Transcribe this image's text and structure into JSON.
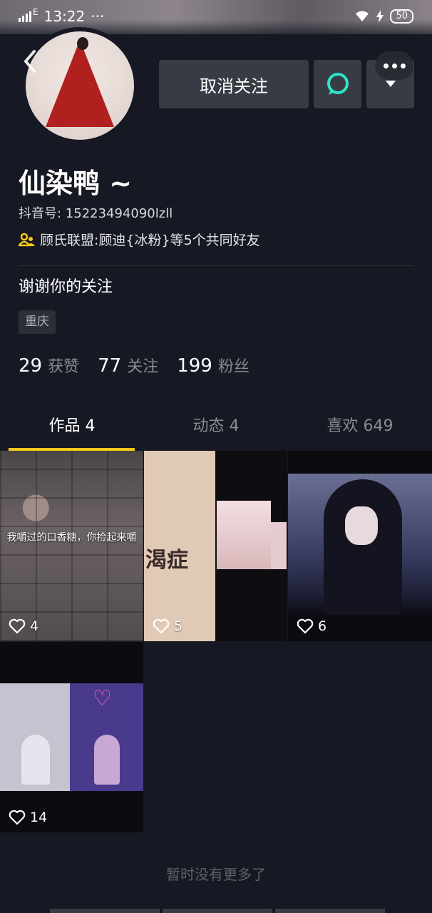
{
  "status_bar": {
    "network": "E",
    "time": "13:22",
    "dots": "···",
    "battery": "50"
  },
  "header": {
    "unfollow_label": "取消关注"
  },
  "profile": {
    "nickname": "仙染鸭 ~",
    "douyin_id": "抖音号: 15223494090lzll",
    "mutual_friends": "顾氏联盟:顾迪{冰粉}等5个共同好友",
    "bio": "谢谢你的关注",
    "location": "重庆"
  },
  "stats": [
    {
      "value": "29",
      "label": "获赞"
    },
    {
      "value": "77",
      "label": "关注"
    },
    {
      "value": "199",
      "label": "粉丝"
    }
  ],
  "tabs": [
    {
      "label": "作品 4",
      "active": true
    },
    {
      "label": "动态 4",
      "active": false
    },
    {
      "label": "喜欢 649",
      "active": false
    }
  ],
  "videos": [
    {
      "likes": "4",
      "caption": "我嚼过的口香糖，你捡起来嚼"
    },
    {
      "likes": "5",
      "caption": "渴症"
    },
    {
      "likes": "6"
    },
    {
      "likes": "14"
    }
  ],
  "footer": {
    "no_more": "暂时没有更多了"
  },
  "colors": {
    "background": "#161823",
    "button": "#393b44",
    "tab_indicator": "#fac81c",
    "chat_icon": "#2de4c7"
  }
}
